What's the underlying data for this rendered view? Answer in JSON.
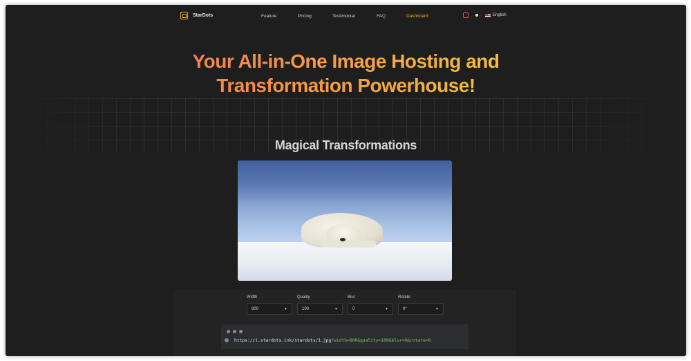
{
  "brand": {
    "name": "StarDots"
  },
  "nav": {
    "items": [
      {
        "label": "Feature",
        "active": false
      },
      {
        "label": "Pricing",
        "active": false
      },
      {
        "label": "Testimonial",
        "active": false
      },
      {
        "label": "FAQ",
        "active": false
      },
      {
        "label": "Dashboard",
        "active": true
      }
    ],
    "language": "English"
  },
  "hero": {
    "line1": "Your All-in-One Image Hosting and",
    "line2": "Transformation Powerhouse!"
  },
  "section": {
    "title": "Magical Transformations"
  },
  "controls": [
    {
      "label": "Width",
      "value": "800"
    },
    {
      "label": "Quality",
      "value": "100"
    },
    {
      "label": "Blur",
      "value": "0"
    },
    {
      "label": "Rotate",
      "value": "0°"
    }
  ],
  "url": {
    "base": "https://i.stardots.ink/stardots/1.jpg",
    "query": "?width=800&quality=100&blur=0&rotate=0"
  },
  "colors": {
    "background": "#1e1e1e",
    "accent": "#f2b01e",
    "gradient_start": "#f0595d",
    "gradient_end": "#f2cf3a",
    "query_green": "#86c36b"
  }
}
